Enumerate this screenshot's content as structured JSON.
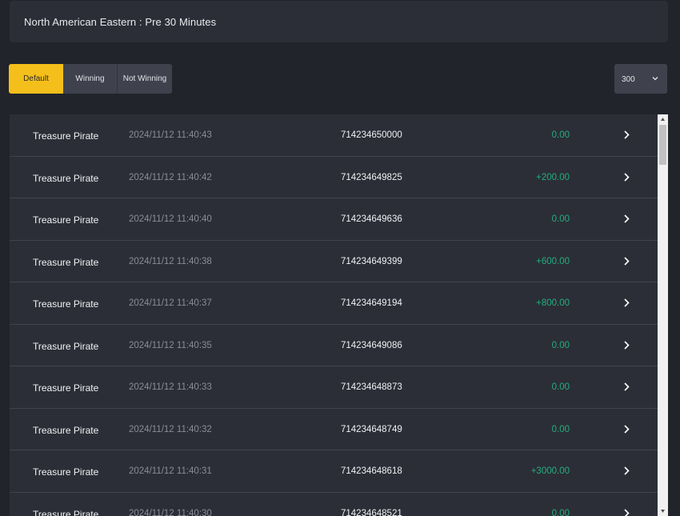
{
  "header": {
    "title": "North American Eastern : Pre 30 Minutes"
  },
  "filters": {
    "tabs": [
      {
        "label": "Default",
        "active": true
      },
      {
        "label": "Winning",
        "active": false
      },
      {
        "label": "Not Winning",
        "active": false
      }
    ],
    "page_size": {
      "value": "300",
      "icon": "chevron-down-icon"
    }
  },
  "colors": {
    "accent": "#f5bf1b",
    "win_amount": "#20b07e",
    "row_bg": "#2c2e37",
    "page_bg": "#22242b"
  },
  "records": [
    {
      "game": "Treasure Pirate",
      "time": "2024/11/12 11:40:43",
      "round_id": "714234650000",
      "amount": "0.00"
    },
    {
      "game": "Treasure Pirate",
      "time": "2024/11/12 11:40:42",
      "round_id": "714234649825",
      "amount": "+200.00"
    },
    {
      "game": "Treasure Pirate",
      "time": "2024/11/12 11:40:40",
      "round_id": "714234649636",
      "amount": "0.00"
    },
    {
      "game": "Treasure Pirate",
      "time": "2024/11/12 11:40:38",
      "round_id": "714234649399",
      "amount": "+600.00"
    },
    {
      "game": "Treasure Pirate",
      "time": "2024/11/12 11:40:37",
      "round_id": "714234649194",
      "amount": "+800.00"
    },
    {
      "game": "Treasure Pirate",
      "time": "2024/11/12 11:40:35",
      "round_id": "714234649086",
      "amount": "0.00"
    },
    {
      "game": "Treasure Pirate",
      "time": "2024/11/12 11:40:33",
      "round_id": "714234648873",
      "amount": "0.00"
    },
    {
      "game": "Treasure Pirate",
      "time": "2024/11/12 11:40:32",
      "round_id": "714234648749",
      "amount": "0.00"
    },
    {
      "game": "Treasure Pirate",
      "time": "2024/11/12 11:40:31",
      "round_id": "714234648618",
      "amount": "+3000.00"
    },
    {
      "game": "Treasure Pirate",
      "time": "2024/11/12 11:40:30",
      "round_id": "714234648521",
      "amount": "0.00"
    }
  ]
}
